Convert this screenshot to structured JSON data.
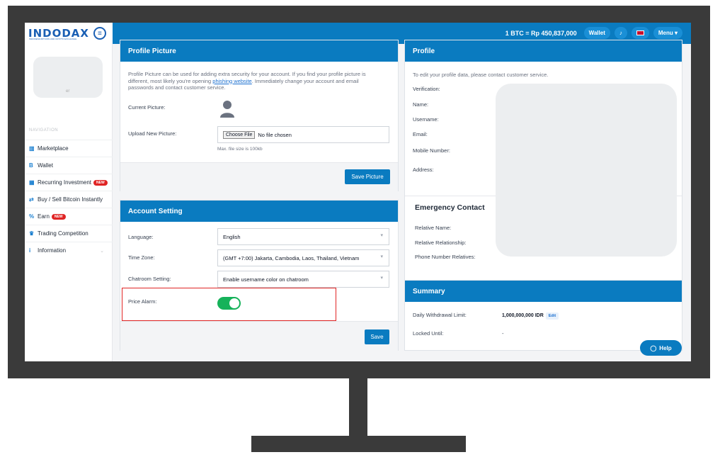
{
  "brand": {
    "logo": "INDODAX",
    "tagline": "INDONESIA BITCOIN AND CRYPTO EXCHANGE"
  },
  "topbar": {
    "btc_price": "1 BTC = Rp 450,837,000",
    "wallet": "Wallet",
    "menu": "Menu"
  },
  "sidebar": {
    "user_tail": "er",
    "heading": "NAVIGATION",
    "items": [
      {
        "icon": "bar-chart-icon",
        "label": "Marketplace"
      },
      {
        "icon": "bitcoin-icon",
        "label": "Wallet"
      },
      {
        "icon": "calendar-icon",
        "label": "Recurring Investment",
        "badge": "NEW"
      },
      {
        "icon": "swap-icon",
        "label": "Buy / Sell Bitcoin Instantly"
      },
      {
        "icon": "percent-icon",
        "label": "Earn",
        "badge": "NEW"
      },
      {
        "icon": "trophy-icon",
        "label": "Trading Competition"
      },
      {
        "icon": "info-icon",
        "label": "Information"
      }
    ]
  },
  "profile_picture": {
    "title": "Profile Picture",
    "desc_1": "Profile Picture can be used for adding extra security for your account. If you find your profile picture is",
    "desc_2a": "different, most likely you're opening ",
    "desc_link": "phishing website",
    "desc_2b": ". Immediately change your account and email",
    "desc_3": "passwords and contact customer service.",
    "current_label": "Current Picture:",
    "upload_label": "Upload New Picture:",
    "choose_file": "Choose File",
    "no_file": "No file chosen",
    "max_size": "Max. file size is 100kb",
    "save_button": "Save Picture"
  },
  "account_setting": {
    "title": "Account Setting",
    "language_label": "Language:",
    "language_value": "English",
    "timezone_label": "Time Zone:",
    "timezone_value": "(GMT +7:00) Jakarta, Cambodia, Laos, Thailand, Vietnam",
    "chatroom_label": "Chatroom Setting:",
    "chatroom_value": "Enable username color on chatroom",
    "price_alarm_label": "Price Alarm:",
    "price_alarm_on": true,
    "save_button": "Save"
  },
  "profile": {
    "title": "Profile",
    "note": "To edit your profile data, please contact customer service.",
    "verification": "Verification:",
    "name": "Name:",
    "username": "Username:",
    "email": "Email:",
    "mobile": "Mobile Number:",
    "address": "Address:"
  },
  "emergency": {
    "title": "Emergency Contact",
    "relative_name": "Relative Name:",
    "relative_relationship": "Relative Relationship:",
    "phone_relatives": "Phone Number Relatives:"
  },
  "summary": {
    "title": "Summary",
    "withdrawal_label": "Daily Withdrawal Limit:",
    "withdrawal_value": "1,000,000,000 IDR",
    "edit": "Edit",
    "locked_label": "Locked Until:",
    "locked_value": "-"
  },
  "help": {
    "label": "Help"
  },
  "colors": {
    "brand_blue": "#0a7bc0",
    "toggle_green": "#16b25a",
    "badge_red": "#e02424",
    "highlight_red": "#e02424"
  }
}
